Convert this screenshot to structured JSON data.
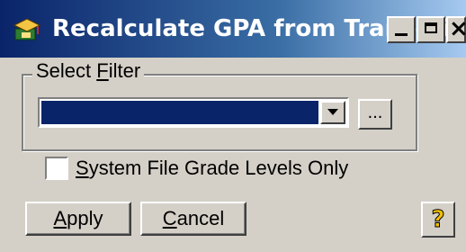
{
  "window": {
    "title": "Recalculate GPA from Transcript",
    "close_glyph": "×",
    "icon": "graduation-cap-icon"
  },
  "filter_group": {
    "legend_pre": "Select ",
    "legend_mnemonic": "F",
    "legend_post": "ilter",
    "selected_value": "",
    "ellipsis_label": "..."
  },
  "options": {
    "system_grade_levels_mnemonic": "S",
    "system_grade_levels_rest": "ystem File Grade Levels Only",
    "system_grade_levels_checked": false
  },
  "buttons": {
    "apply_mnemonic": "A",
    "apply_rest": "pply",
    "cancel_mnemonic": "C",
    "cancel_rest": "ancel",
    "help_glyph": "?"
  },
  "colors": {
    "face": "#d4d0c8",
    "title_start": "#0a246a",
    "title_end": "#a6caf0",
    "selection": "#0a246a"
  }
}
